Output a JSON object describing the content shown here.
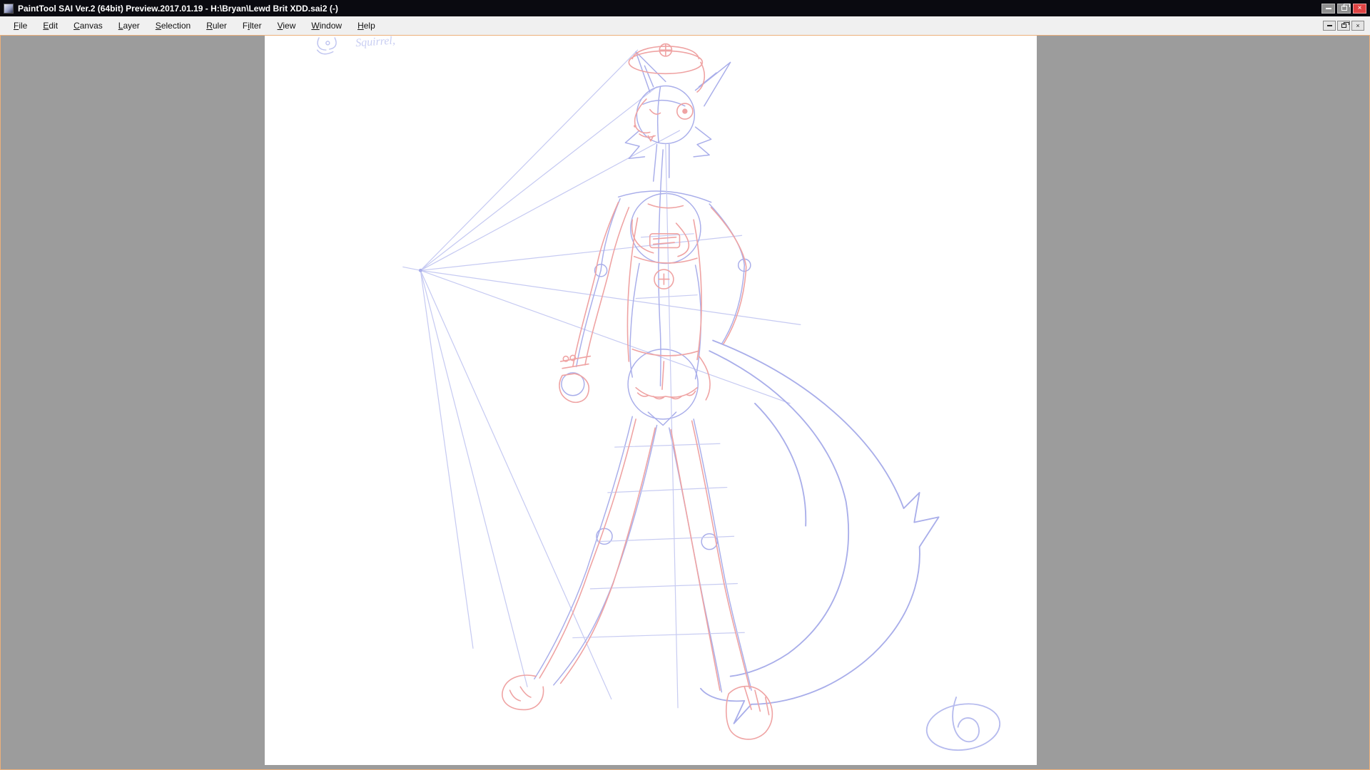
{
  "titlebar": {
    "title": "PaintTool SAI Ver.2 (64bit) Preview.2017.01.19 - H:\\Bryan\\Lewd Brit XDD.sai2 (-)",
    "buttons": [
      {
        "name": "minimize"
      },
      {
        "name": "restore"
      },
      {
        "name": "close",
        "glyph": "×"
      }
    ]
  },
  "menubar": {
    "items": [
      {
        "id": "file",
        "label": "File",
        "accessKeyIndex": 0
      },
      {
        "id": "edit",
        "label": "Edit",
        "accessKeyIndex": 0
      },
      {
        "id": "canvas",
        "label": "Canvas",
        "accessKeyIndex": 0
      },
      {
        "id": "layer",
        "label": "Layer",
        "accessKeyIndex": 0
      },
      {
        "id": "selection",
        "label": "Selection",
        "accessKeyIndex": 0
      },
      {
        "id": "ruler",
        "label": "Ruler",
        "accessKeyIndex": 0
      },
      {
        "id": "filter",
        "label": "Filter",
        "accessKeyIndex": 1
      },
      {
        "id": "view",
        "label": "View",
        "accessKeyIndex": 0
      },
      {
        "id": "window",
        "label": "Window",
        "accessKeyIndex": 0
      },
      {
        "id": "help",
        "label": "Help",
        "accessKeyIndex": 0
      }
    ],
    "mdi_buttons": [
      {
        "name": "mdi-minimize"
      },
      {
        "name": "mdi-restore"
      },
      {
        "name": "mdi-close",
        "glyph": "×"
      }
    ]
  },
  "canvas": {
    "note": "Squirrel,"
  },
  "colors": {
    "titlebar_bg": "#0a0a10",
    "close_red": "#e04343",
    "workspace_bg": "#9c9c9c",
    "viewport_border": "#edb07a",
    "canvas_bg": "#ffffff",
    "sketch_blue": "#a9aeea",
    "sketch_blue_light": "#c6caf2",
    "sketch_red": "#efa3a3"
  }
}
